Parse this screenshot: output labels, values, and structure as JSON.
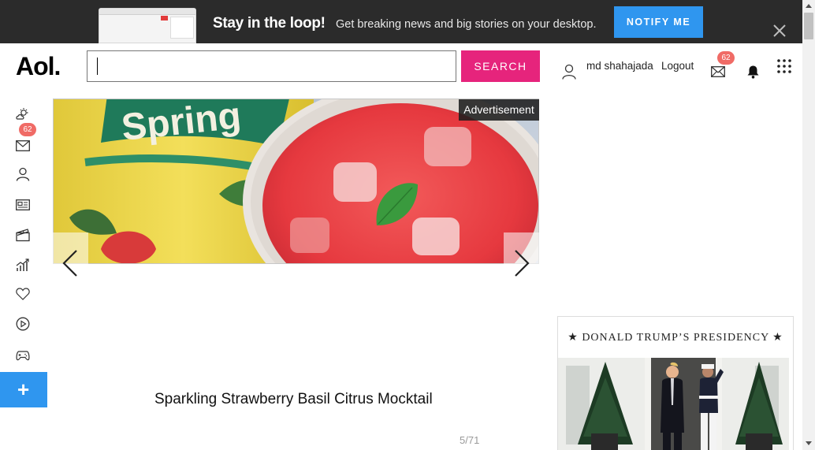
{
  "banner": {
    "headline": "Stay in the loop!",
    "subtext": "Get breaking news and big stories on your desktop.",
    "notify_label": "NOTIFY ME",
    "close_icon": "close-icon"
  },
  "header": {
    "logo": "Aol.",
    "search": {
      "value": "",
      "button_label": "SEARCH"
    },
    "user": {
      "name": "md shahajada",
      "logout_label": "Logout"
    },
    "mail_count": "62",
    "icons": [
      "user-icon",
      "mail-icon",
      "bell-icon",
      "apps-grid-icon"
    ]
  },
  "sidebar": {
    "mail_count": "62",
    "items": [
      {
        "icon": "weather-icon"
      },
      {
        "icon": "mail-icon"
      },
      {
        "icon": "profile-icon"
      },
      {
        "icon": "news-icon"
      },
      {
        "icon": "entertainment-icon"
      },
      {
        "icon": "finance-icon"
      },
      {
        "icon": "lifestyle-icon"
      },
      {
        "icon": "video-icon"
      },
      {
        "icon": "games-icon"
      }
    ],
    "plus_label": "+"
  },
  "slideshow": {
    "ad_label": "Advertisement",
    "caption": "Sparkling Strawberry Basil Citrus Mocktail",
    "counter": "5/71",
    "bottle_text": "Spring"
  },
  "news_card": {
    "title": "★ DONALD TRUMP’S PRESIDENCY ★"
  },
  "colors": {
    "banner_bg": "#2b2b2b",
    "notify_blue": "#2f96ef",
    "search_pink": "#e6247c",
    "badge_red": "#f06b66"
  }
}
